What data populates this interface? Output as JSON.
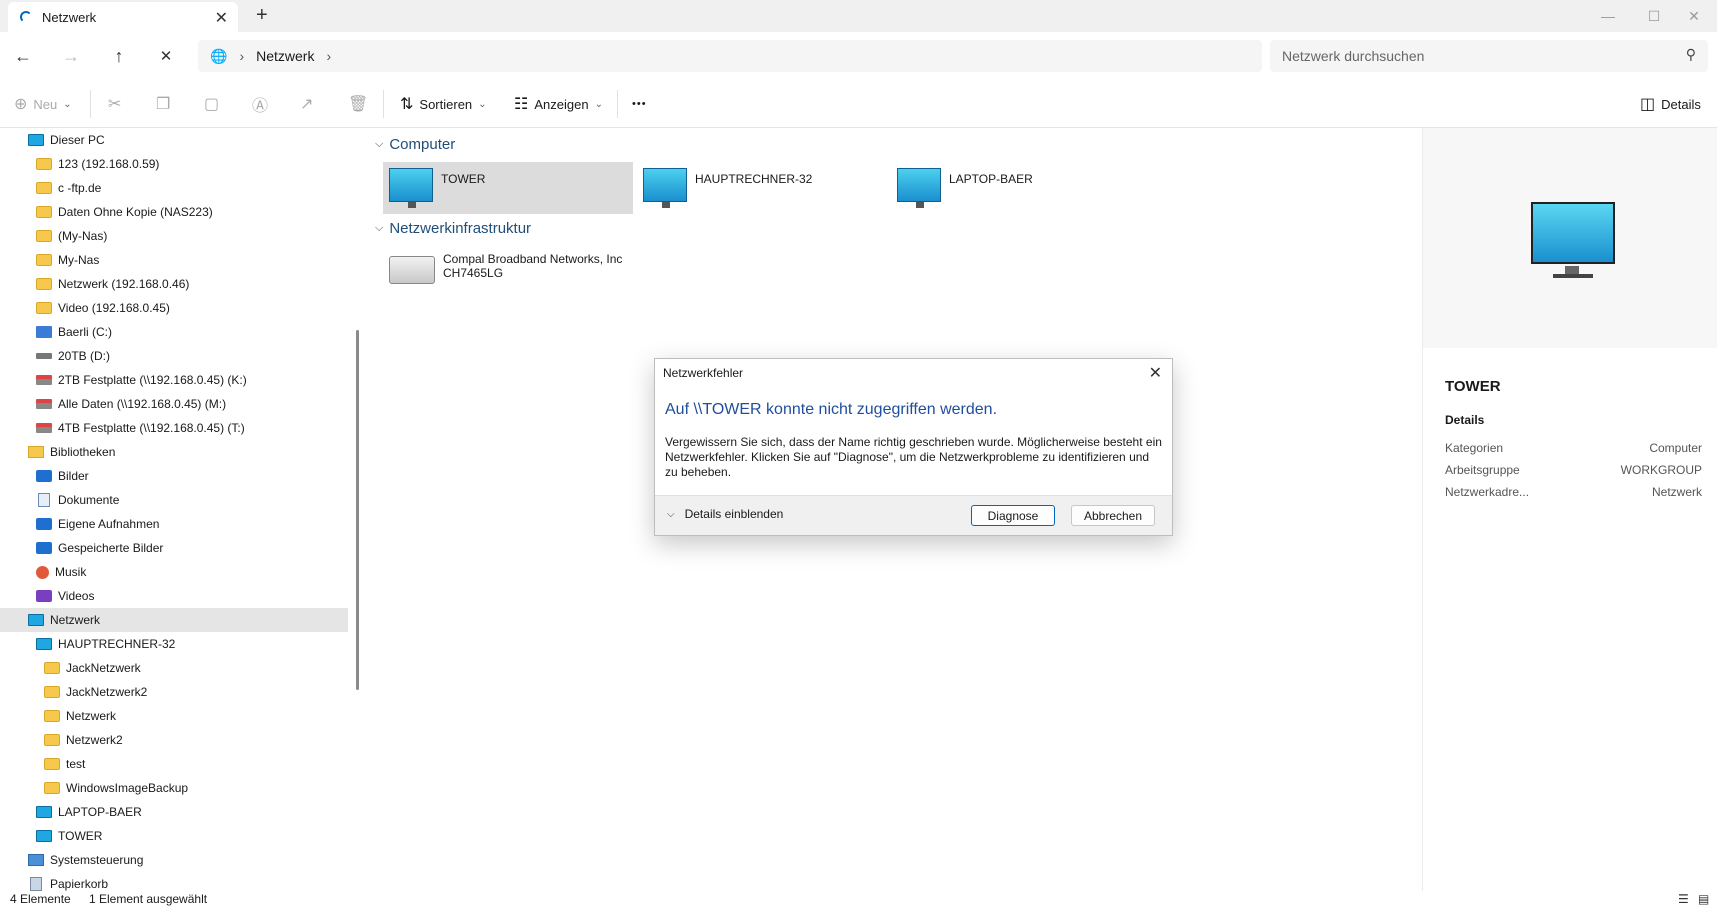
{
  "window": {
    "tab_title": "Netzwerk",
    "tab_close": "✕",
    "new_tab": "+",
    "minimize": "—",
    "maximize": "☐",
    "close": "✕"
  },
  "address": {
    "back": "←",
    "forward": "→",
    "up": "↑",
    "stop": "✕",
    "location_icon": "globe-icon",
    "path": [
      "Netzwerk"
    ],
    "search_placeholder": "Netzwerk durchsuchen"
  },
  "toolbar": {
    "new_label": "Neu",
    "sort_label": "Sortieren",
    "view_label": "Anzeigen",
    "more_label": "•••",
    "details_label": "Details"
  },
  "sidebar": {
    "items": [
      {
        "label": "Dieser PC",
        "indent": 1,
        "icon": "pc-icon"
      },
      {
        "label": "123 (192.168.0.59)",
        "indent": 2,
        "icon": "folder-icon"
      },
      {
        "label": "c       -ftp.de",
        "indent": 2,
        "icon": "folder-icon"
      },
      {
        "label": "Daten Ohne Kopie (NAS223)",
        "indent": 2,
        "icon": "folder-icon"
      },
      {
        "label": "                 (My-Nas)",
        "indent": 2,
        "icon": "folder-icon"
      },
      {
        "label": "My-Nas",
        "indent": 2,
        "icon": "folder-icon"
      },
      {
        "label": "Netzwerk (192.168.0.46)",
        "indent": 2,
        "icon": "folder-icon"
      },
      {
        "label": "Video (192.168.0.45)",
        "indent": 2,
        "icon": "folder-icon"
      },
      {
        "label": "Baerli (C:)",
        "indent": 2,
        "icon": "system-drive-icon"
      },
      {
        "label": "20TB (D:)",
        "indent": 2,
        "icon": "drive-icon"
      },
      {
        "label": "2TB Festplatte (\\\\192.168.0.45) (K:)",
        "indent": 2,
        "icon": "network-drive-icon"
      },
      {
        "label": "Alle Daten (\\\\192.168.0.45) (M:)",
        "indent": 2,
        "icon": "network-drive-icon"
      },
      {
        "label": "4TB Festplatte (\\\\192.168.0.45) (T:)",
        "indent": 2,
        "icon": "network-drive-icon"
      },
      {
        "label": "Bibliotheken",
        "indent": 1,
        "icon": "library-icon"
      },
      {
        "label": "Bilder",
        "indent": 2,
        "icon": "pictures-icon"
      },
      {
        "label": "Dokumente",
        "indent": 2,
        "icon": "documents-icon"
      },
      {
        "label": "Eigene Aufnahmen",
        "indent": 2,
        "icon": "pictures-icon"
      },
      {
        "label": "Gespeicherte Bilder",
        "indent": 2,
        "icon": "pictures-icon"
      },
      {
        "label": "Musik",
        "indent": 2,
        "icon": "music-icon"
      },
      {
        "label": "Videos",
        "indent": 2,
        "icon": "video-icon"
      },
      {
        "label": "Netzwerk",
        "indent": 1,
        "icon": "network-icon",
        "selected": true
      },
      {
        "label": "HAUPTRECHNER-32",
        "indent": 2,
        "icon": "pc-icon"
      },
      {
        "label": "JackNetzwerk",
        "indent": 3,
        "icon": "folder-icon"
      },
      {
        "label": "JackNetzwerk2",
        "indent": 3,
        "icon": "folder-icon"
      },
      {
        "label": "Netzwerk",
        "indent": 3,
        "icon": "folder-icon"
      },
      {
        "label": "Netzwerk2",
        "indent": 3,
        "icon": "folder-icon"
      },
      {
        "label": "test",
        "indent": 3,
        "icon": "folder-icon"
      },
      {
        "label": "WindowsImageBackup",
        "indent": 3,
        "icon": "folder-icon"
      },
      {
        "label": "LAPTOP-BAER",
        "indent": 2,
        "icon": "pc-icon"
      },
      {
        "label": "TOWER",
        "indent": 2,
        "icon": "pc-icon"
      },
      {
        "label": "Systemsteuerung",
        "indent": 1,
        "icon": "control-panel-icon"
      },
      {
        "label": "Papierkorb",
        "indent": 1,
        "icon": "recycle-bin-icon"
      }
    ]
  },
  "content": {
    "groups": [
      {
        "header": "Computer",
        "items": [
          {
            "name": "TOWER",
            "selected": true
          },
          {
            "name": "HAUPTRECHNER-32"
          },
          {
            "name": "LAPTOP-BAER"
          }
        ]
      },
      {
        "header": "Netzwerkinfrastruktur",
        "items": [
          {
            "name": "Compal Broadband Networks, Inc",
            "name2": "CH7465LG"
          }
        ]
      }
    ]
  },
  "details": {
    "title": "TOWER",
    "subtitle": "Details",
    "rows": [
      {
        "key": "Kategorien",
        "value": "Computer"
      },
      {
        "key": "Arbeitsgruppe",
        "value": "WORKGROUP"
      },
      {
        "key": "Netzwerkadre...",
        "value": "Netzwerk"
      }
    ]
  },
  "status": {
    "count": "4 Elemente",
    "selected": "1 Element ausgewählt"
  },
  "dialog": {
    "title": "Netzwerkfehler",
    "close": "✕",
    "main": "Auf \\\\TOWER konnte nicht zugegriffen werden.",
    "text": "Vergewissern Sie sich, dass der Name richtig geschrieben wurde. Möglicherweise besteht ein Netzwerkfehler. Klicken Sie auf \"Diagnose\", um die Netzwerkprobleme zu identifizieren und zu beheben.",
    "details_label": "Details einblenden",
    "diagnose_label": "Diagnose",
    "cancel_label": "Abbrechen"
  }
}
